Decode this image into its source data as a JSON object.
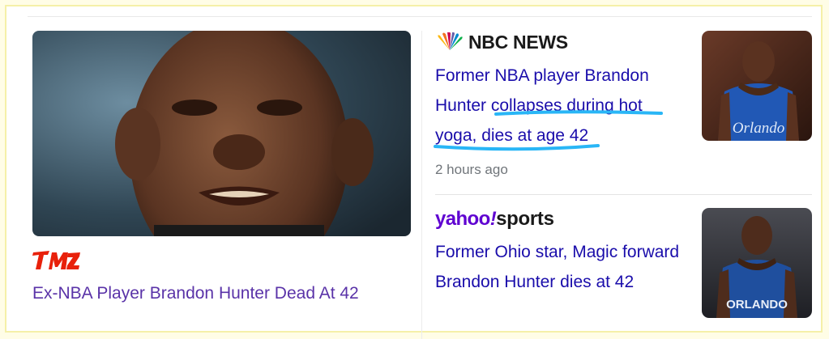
{
  "left_story": {
    "source": "TMZ",
    "title": "Ex-NBA Player Brandon Hunter Dead At 42"
  },
  "right_stories": [
    {
      "source": "NBC NEWS",
      "title": "Former NBA player Brandon Hunter collapses during hot yoga, dies at age 42",
      "time": "2 hours ago",
      "thumb_jersey_text": "Orlando"
    },
    {
      "source_brand": "yahoo",
      "source_bang": "!",
      "source_product": "sports",
      "title": "Former Ohio star, Magic forward Brandon Hunter dies at 42",
      "thumb_jersey_text": "ORLANDO"
    }
  ],
  "colors": {
    "link": "#1a0dab",
    "visited_link": "#5a33a8",
    "highlight": "#29b6f6",
    "tmz_red": "#e8210b",
    "yahoo_purple": "#5f01d1"
  },
  "icons": [
    "nbc-peacock-logo-icon",
    "tmz-logo-icon"
  ]
}
